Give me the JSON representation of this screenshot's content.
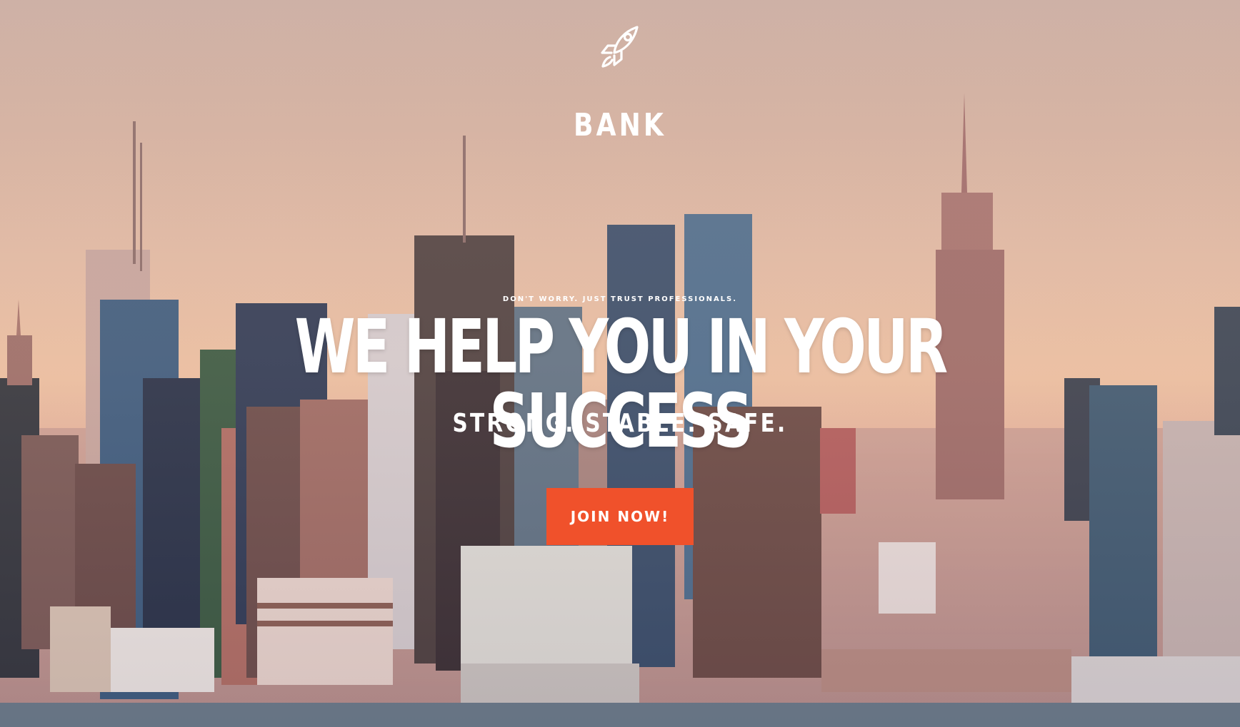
{
  "brand": {
    "name": "BANK",
    "logo_icon": "rocket-icon"
  },
  "hero": {
    "tagline": "DON'T WORRY. JUST TRUST PROFESSIONALS.",
    "headline": "WE HELP YOU IN YOUR SUCCESS",
    "subheadline": "STRONG. STABLE. SAFE.",
    "cta_label": "JOIN NOW!"
  },
  "colors": {
    "accent": "#f0512b",
    "text": "#ffffff",
    "sky_top": "#cdb0a6",
    "sky_bottom": "#ecc0a3"
  }
}
